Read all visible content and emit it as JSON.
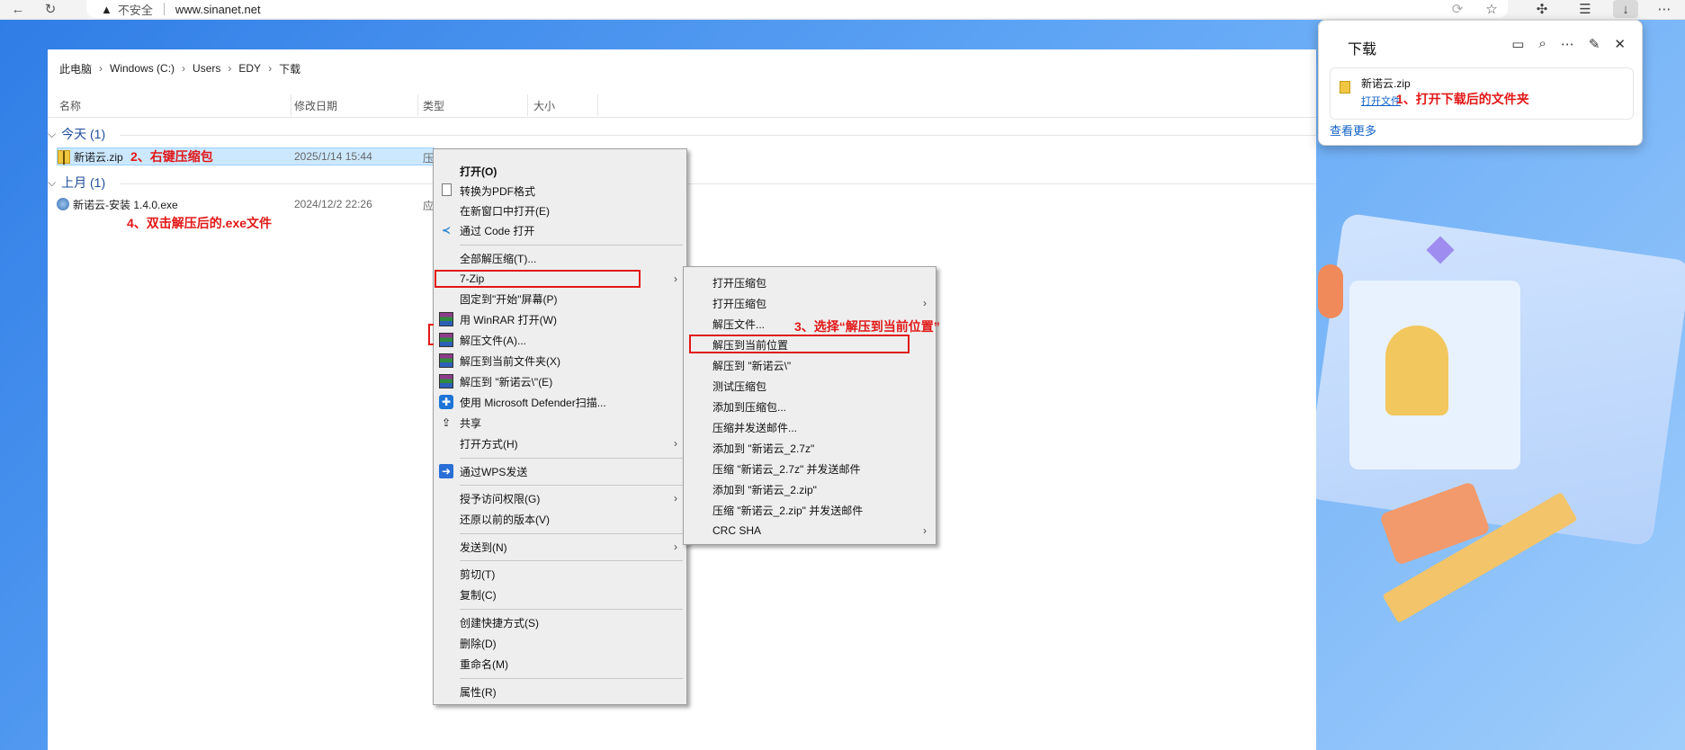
{
  "browser": {
    "address_warning": "不安全",
    "url": "www.sinanet.net"
  },
  "explorer": {
    "breadcrumb": [
      "此电脑",
      "Windows (C:)",
      "Users",
      "EDY",
      "下载"
    ],
    "columns": [
      "名称",
      "修改日期",
      "类型",
      "大小"
    ],
    "groups": [
      {
        "label": "今天 (1)",
        "files": [
          {
            "name": "新诺云.zip",
            "date": "2025/1/14 15:44",
            "type": "压"
          }
        ]
      },
      {
        "label": "上月 (1)",
        "files": [
          {
            "name": "新诺云-安装 1.4.0.exe",
            "date": "2024/12/2 22:26",
            "type": "应"
          }
        ]
      }
    ]
  },
  "annotations": {
    "step1": "1、打开下载后的文件夹",
    "step2": "2、右键压缩包",
    "step3": "3、选择“解压到当前位置”",
    "step4": "4、双击解压后的.exe文件"
  },
  "context_menu": {
    "items": [
      "打开(O)",
      "转换为PDF格式",
      "在新窗口中打开(E)",
      "通过 Code 打开",
      "全部解压缩(T)...",
      "7-Zip",
      "固定到\"开始\"屏幕(P)",
      "用 WinRAR 打开(W)",
      "解压文件(A)...",
      "解压到当前文件夹(X)",
      "解压到 \"新诺云\\\"(E)",
      "使用 Microsoft Defender扫描...",
      "共享",
      "打开方式(H)",
      "通过WPS发送",
      "授予访问权限(G)",
      "还原以前的版本(V)",
      "发送到(N)",
      "剪切(T)",
      "复制(C)",
      "创建快捷方式(S)",
      "删除(D)",
      "重命名(M)",
      "属性(R)"
    ]
  },
  "submenu_7zip": {
    "items": [
      "打开压缩包",
      "打开压缩包",
      "解压文件...",
      "解压到当前位置",
      "解压到 \"新诺云\\\"",
      "测试压缩包",
      "添加到压缩包...",
      "压缩并发送邮件...",
      "添加到 \"新诺云_2.7z\"",
      "压缩 \"新诺云_2.7z\" 并发送邮件",
      "添加到 \"新诺云_2.zip\"",
      "压缩 \"新诺云_2.zip\" 并发送邮件",
      "CRC SHA"
    ]
  },
  "downloads_panel": {
    "title": "下载",
    "file_name": "新诺云.zip",
    "open_file": "打开文件",
    "see_more": "查看更多"
  },
  "icons": {
    "toolbar": [
      "back-icon",
      "refresh-icon",
      "read-aloud-icon",
      "favorite-icon",
      "extensions-icon",
      "favorites-icon",
      "downloads-icon",
      "more-icon"
    ],
    "downloads_panel": [
      "folder-icon",
      "search-icon",
      "more-icon",
      "pin-icon",
      "close-icon"
    ]
  },
  "colors": {
    "annotation_red": "#e21717",
    "selection_blue": "#cce8ff",
    "link_blue": "#0f62c8",
    "group_blue": "#1e4c9a"
  }
}
